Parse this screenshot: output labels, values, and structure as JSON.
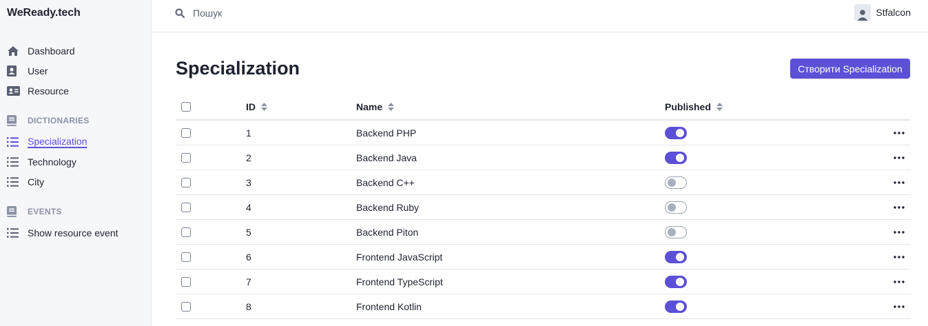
{
  "app": {
    "brand": "WeReady.tech"
  },
  "sidebar": {
    "items": [
      {
        "label": "Dashboard",
        "icon": "home-icon"
      },
      {
        "label": "User",
        "icon": "user-card-icon"
      },
      {
        "label": "Resource",
        "icon": "id-card-icon"
      }
    ],
    "sections": [
      {
        "title": "DICTIONARIES",
        "icon": "book-icon",
        "items": [
          {
            "label": "Specialization",
            "icon": "list-icon",
            "active": true
          },
          {
            "label": "Technology",
            "icon": "list-icon"
          },
          {
            "label": "City",
            "icon": "list-icon"
          }
        ]
      },
      {
        "title": "EVENTS",
        "icon": "book-icon",
        "items": [
          {
            "label": "Show resource event",
            "icon": "list-icon"
          }
        ]
      }
    ]
  },
  "topbar": {
    "search": {
      "placeholder": "Пошук",
      "value": ""
    },
    "user": {
      "name": "Stfalcon"
    }
  },
  "main": {
    "title": "Specialization",
    "create_label": "Створити Specialization",
    "table": {
      "columns": [
        "ID",
        "Name",
        "Published"
      ],
      "rows": [
        {
          "id": "1",
          "name": "Backend PHP",
          "published": true
        },
        {
          "id": "2",
          "name": "Backend Java",
          "published": true
        },
        {
          "id": "3",
          "name": "Backend C++",
          "published": false
        },
        {
          "id": "4",
          "name": "Backend Ruby",
          "published": false
        },
        {
          "id": "5",
          "name": "Backend Piton",
          "published": false
        },
        {
          "id": "6",
          "name": "Frontend JavaScript",
          "published": true
        },
        {
          "id": "7",
          "name": "Frontend TypeScript",
          "published": true
        },
        {
          "id": "8",
          "name": "Frontend Kotlin",
          "published": true
        }
      ]
    }
  },
  "colors": {
    "accent": "#5b50d6",
    "sidebar_bg": "#f6f7fa",
    "border": "#e4e6ec",
    "text": "#1f2330",
    "muted": "#8b92a5"
  }
}
